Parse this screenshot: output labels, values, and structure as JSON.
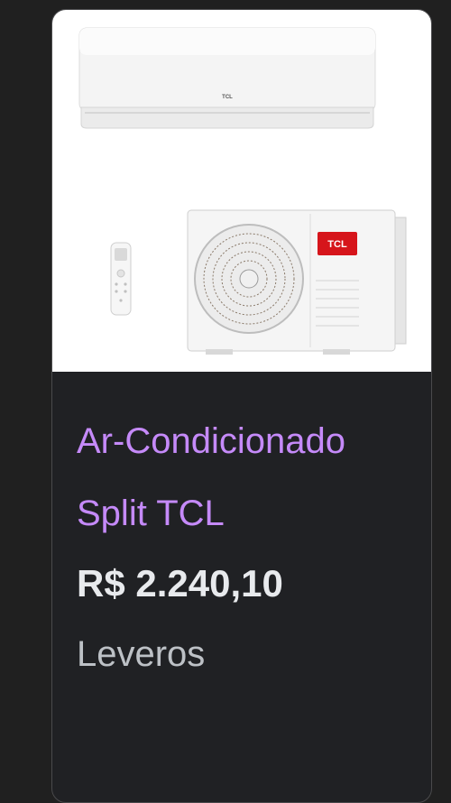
{
  "product": {
    "title": "Ar-Condicionado Split TCL",
    "price": "R$ 2.240,10",
    "seller": "Leveros",
    "image_brand_text": "TCL"
  },
  "colors": {
    "title": "#c58af9",
    "price": "#e8eaed",
    "seller": "#bdc1c6",
    "card_bg": "#202124",
    "page_bg": "#202020",
    "brand_red": "#d6151b"
  }
}
